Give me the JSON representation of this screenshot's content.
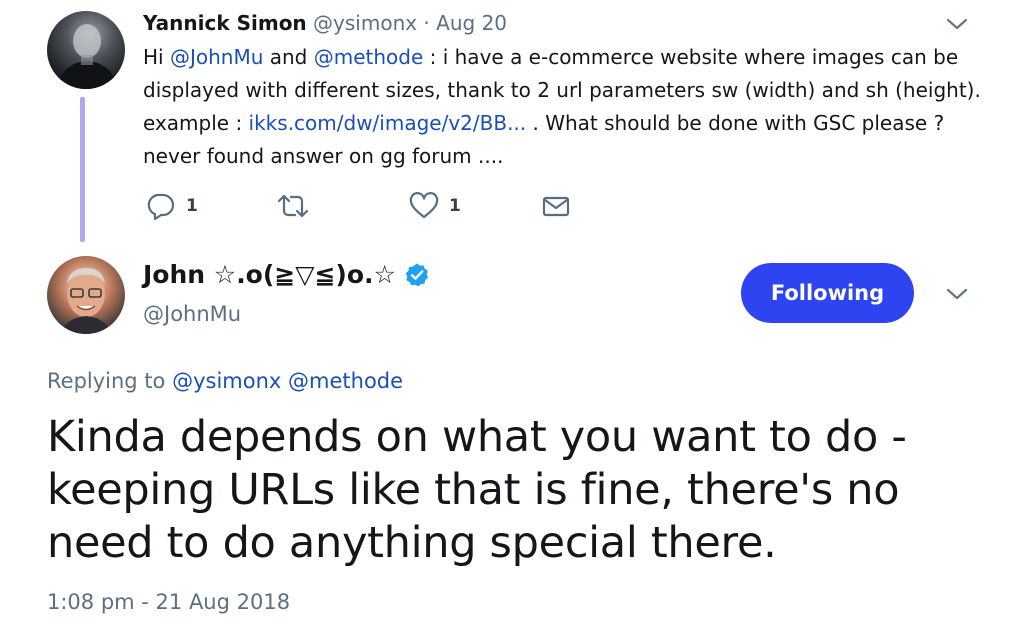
{
  "parent_tweet": {
    "author_name": "Yannick Simon",
    "author_handle": "@ysimonx",
    "separator": " · ",
    "date": "Aug 20",
    "text": {
      "t1": "Hi ",
      "mention1": "@JohnMu",
      "t2": " and ",
      "mention2": "@methode",
      "t3": " : i have a e-commerce website where images can be displayed with different sizes, thank to 2 url parameters sw (width) and sh (height). example : ",
      "link": "ikks.com/dw/image/v2/BB...",
      "t4": " . What should be done with GSC please ? never found answer on gg forum ...."
    },
    "actions": {
      "reply_icon": "reply-icon",
      "reply_count": "1",
      "retweet_icon": "retweet-icon",
      "like_icon": "heart-icon",
      "like_count": "1",
      "dm_icon": "envelope-icon"
    }
  },
  "main_tweet": {
    "author_name": "John ☆.o(≧▽≦)o.☆",
    "author_handle": "@JohnMu",
    "verified_icon": "verified-badge-icon",
    "follow_label": "Following",
    "replying_to_label": "Replying to",
    "replying_to": [
      "@ysimonx",
      "@methode"
    ],
    "text": "Kinda depends on what you want to do - keeping URLs like that is fine, there's no need to do anything special there.",
    "timestamp": "1:08 pm - 21 Aug 2018"
  },
  "colors": {
    "link": "#1b4fb8",
    "follow_button": "#2e44f0",
    "thread_line": "#b5a5ef",
    "verified": "#1da1f2",
    "muted": "#5b7083"
  }
}
